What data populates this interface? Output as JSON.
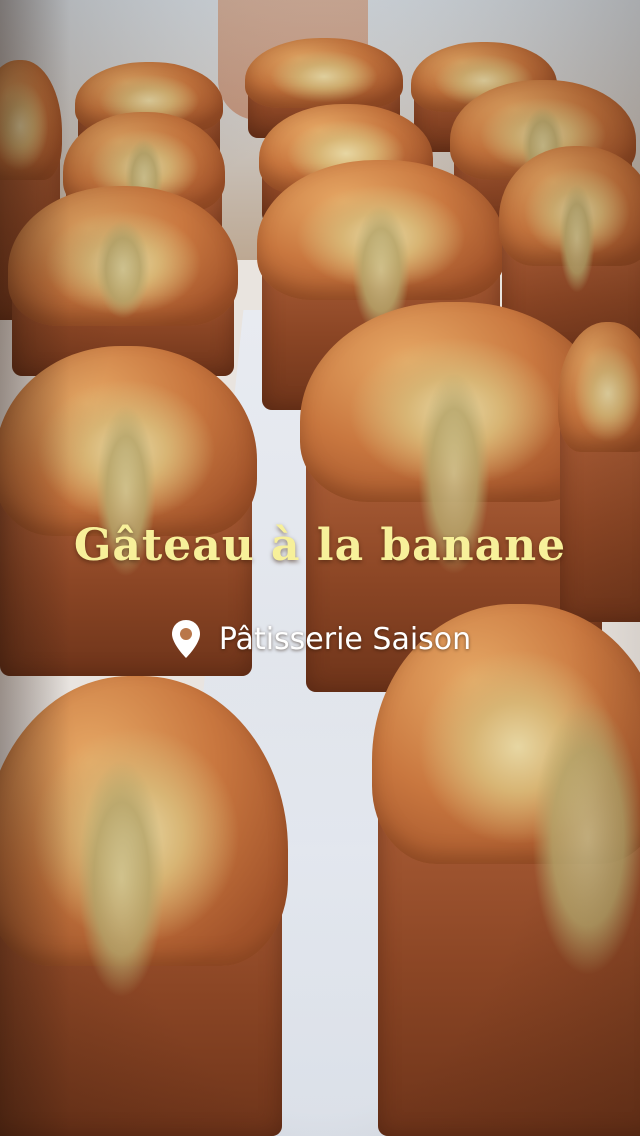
{
  "story": {
    "title": "Gâteau à la banane",
    "location": {
      "icon": "location-pin-icon",
      "label": "Pâtisserie Saison"
    }
  },
  "colors": {
    "title_text": "#f7f09a",
    "location_text": "#ffffff"
  }
}
